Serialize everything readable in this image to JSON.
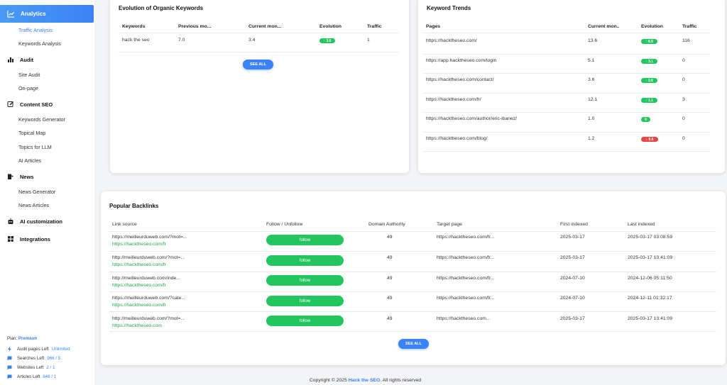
{
  "sidebar": {
    "active_item": "Analytics",
    "groups": [
      {
        "label": "Audit",
        "icon": "audit-icon"
      },
      {
        "label": "Content SEO",
        "icon": "edit-icon"
      },
      {
        "label": "News",
        "icon": "news-icon"
      },
      {
        "label": "AI customization",
        "icon": "robot-icon"
      },
      {
        "label": "Integrations",
        "icon": "blocks-icon"
      }
    ],
    "analytics_sub": [
      "Traffic Analysis",
      "Keywords Analysis"
    ],
    "audit_sub": [
      "Site Audit",
      "On-page"
    ],
    "content_sub": [
      "Keywords Generator",
      "Topical Map",
      "Topics for LLM",
      "AI Articles"
    ],
    "news_sub": [
      "News Generator",
      "News Articles"
    ],
    "plan": {
      "label": "Plan:",
      "value": "Premium"
    },
    "usage": [
      {
        "label": "Audit pages Left",
        "value": "Unlimited",
        "icon": "bolt-icon"
      },
      {
        "label": "Searches Left",
        "value": "966 / 5",
        "icon": "chat-icon"
      },
      {
        "label": "Websites Left",
        "value": "2 / 1",
        "icon": "chat-icon"
      },
      {
        "label": "Articles Left",
        "value": "646 / 1",
        "icon": "chat-icon"
      }
    ]
  },
  "organic": {
    "title": "Evolution of Organic Keywords",
    "headers": [
      "Keywords",
      "Previous mo...",
      "Current mon...",
      "Evolution",
      "Traffic"
    ],
    "rows": [
      {
        "keyword": "hack the seo",
        "previous": "7.0",
        "current": "3.4",
        "evolution": "↑ 3.6",
        "traffic": "1"
      }
    ],
    "see_all": "SEE ALL"
  },
  "trends": {
    "title": "Keyword Trends",
    "headers": [
      "Pages",
      "Current mon..",
      "Evolution",
      "Traffic"
    ],
    "rows": [
      {
        "page": "https://hacktheseo.com/",
        "current": "13.6",
        "evolution": "↑ 6.5",
        "trend": "up",
        "traffic": "116"
      },
      {
        "page": "https://app.hacktheseo.com/login",
        "current": "5.1",
        "evolution": "↑ 3.1",
        "trend": "up",
        "traffic": "0"
      },
      {
        "page": "https://hacktheseo.com/contact/",
        "current": "3.6",
        "evolution": "↑ 2.6",
        "trend": "up",
        "traffic": "0"
      },
      {
        "page": "https://hacktheseo.com/fr/",
        "current": "12.1",
        "evolution": "↑ 1.1",
        "trend": "up",
        "traffic": "3"
      },
      {
        "page": "https://hacktheseo.com/author/eric-ibanez/",
        "current": "1.0",
        "evolution": "0",
        "trend": "up",
        "traffic": "0"
      },
      {
        "page": "https://hacktheseo.com/blog/",
        "current": "1.2",
        "evolution": "↓ 0.6",
        "trend": "down",
        "traffic": "0"
      }
    ]
  },
  "backlinks": {
    "title": "Popular Backlinks",
    "headers": [
      "Link source",
      "Follow / Unfollow",
      "Domain Authority",
      "Target page",
      "First indexed",
      "Last indexed"
    ],
    "rows": [
      {
        "source": "https://meilleurduweb.com/?mot=...",
        "anchor": "https://hacktheseo.com/fr",
        "follow": "follow",
        "da": "49",
        "target": "https://hacktheseo.com/fr...",
        "first": "2025-03-17",
        "last": "2025-03-17 03:08:59"
      },
      {
        "source": "http://meilleurduweb.com/?mot=...",
        "anchor": "https://hacktheseo.com/fr",
        "follow": "follow",
        "da": "49",
        "target": "https://hacktheseo.com/fr...",
        "first": "2025-03-17",
        "last": "2025-03-17 13:41:09"
      },
      {
        "source": "http://meilleurduweb.com/inde...",
        "anchor": "https://hacktheseo.com/fr",
        "follow": "follow",
        "da": "49",
        "target": "https://hacktheseo.com/fr...",
        "first": "2024-07-10",
        "last": "2024-12-06 05:11:50"
      },
      {
        "source": "https://meilleurduweb.com/?cate...",
        "anchor": "https://hacktheseo.com/fr",
        "follow": "follow",
        "da": "49",
        "target": "https://hacktheseo.com/fr...",
        "first": "2024-07-10",
        "last": "2024-12-11 01:32:17"
      },
      {
        "source": "http://meilleurduweb.com/?mot=...",
        "anchor": "https://hacktheseo.com",
        "follow": "follow",
        "da": "49",
        "target": "https://hacktheseo.com...",
        "first": "2025-03-17",
        "last": "2025-03-17 13:41:09"
      }
    ],
    "see_all": "SEE ALL"
  },
  "footer": {
    "prefix": "Copyright © 2025 ",
    "brand": "Hack the SEO",
    "suffix": ". All rights reserved"
  },
  "colors": {
    "accent": "#3b82f6",
    "up": "#22c55e",
    "down": "#ef4444"
  }
}
